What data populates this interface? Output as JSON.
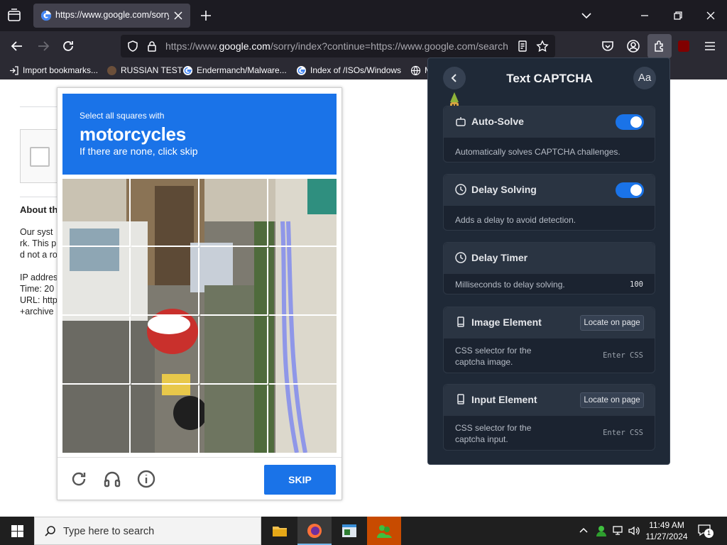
{
  "browser": {
    "tab": {
      "title": "https://www.google.com/sorry/index?continue=https://www.google.com/search"
    },
    "url": {
      "prefix": "https://www.",
      "domain": "google.com",
      "rest": "/sorry/index?continue=https://www.google.com/search"
    },
    "bookmarks": [
      {
        "label": "Import bookmarks..."
      },
      {
        "label": "RUSSIAN TEST"
      },
      {
        "label": "Endermanch/Malware..."
      },
      {
        "label": "Index of /ISOs/Windows"
      },
      {
        "label": "M"
      }
    ]
  },
  "page": {
    "about_title": "About th",
    "lines": [
      "Our syst",
      "rk. This p",
      "d not a ro",
      "IP addres",
      "Time: 20",
      "URL: http",
      "+archive"
    ]
  },
  "captcha": {
    "instruction_small": "Select all squares with",
    "target": "motorcycles",
    "instruction_sub": "If there are none, click skip",
    "skip_label": "SKIP"
  },
  "extension": {
    "title": "Text CAPTCHA",
    "font_button": "Aa",
    "settings": [
      {
        "title": "Auto-Solve",
        "description": "Automatically solves CAPTCHA challenges.",
        "enabled": true
      },
      {
        "title": "Delay Solving",
        "description": "Adds a delay to avoid detection.",
        "enabled": true
      },
      {
        "title": "Delay Timer",
        "description": "Milliseconds to delay solving.",
        "value": "100"
      },
      {
        "title": "Image Element",
        "button": "Locate on page",
        "description_line1": "CSS selector for the",
        "description_line2": "captcha image.",
        "placeholder": "Enter CSS"
      },
      {
        "title": "Input Element",
        "button": "Locate on page",
        "description_line1": "CSS selector for the",
        "description_line2": "captcha input.",
        "placeholder": "Enter CSS"
      }
    ]
  },
  "taskbar": {
    "search_placeholder": "Type here to search",
    "time": "11:49 AM",
    "date": "11/27/2024",
    "notification_count": "1"
  },
  "colors": {
    "captcha_blue": "#1a73e8",
    "toggle_on": "#1a73e8",
    "popup_bg": "#1f2937"
  }
}
